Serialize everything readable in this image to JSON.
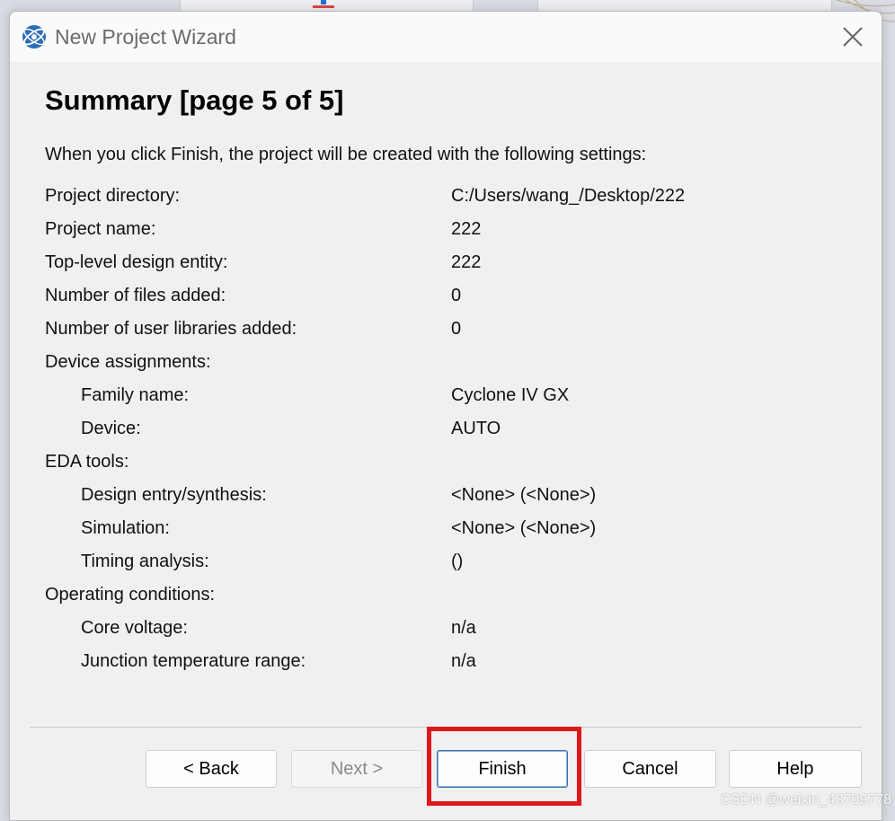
{
  "window": {
    "title": "New Project Wizard"
  },
  "page": {
    "heading": "Summary [page 5 of 5]",
    "intro": "When you click Finish, the project will be created with the following settings:"
  },
  "settings": [
    {
      "label": "Project directory:",
      "value": "C:/Users/wang_/Desktop/222",
      "indent": false
    },
    {
      "label": "Project name:",
      "value": "222",
      "indent": false
    },
    {
      "label": "Top-level design entity:",
      "value": "222",
      "indent": false
    },
    {
      "label": "Number of files added:",
      "value": "0",
      "indent": false
    },
    {
      "label": "Number of user libraries added:",
      "value": "0",
      "indent": false
    },
    {
      "label": "Device assignments:",
      "value": "",
      "indent": false
    },
    {
      "label": "Family name:",
      "value": "Cyclone IV GX",
      "indent": true
    },
    {
      "label": "Device:",
      "value": "AUTO",
      "indent": true
    },
    {
      "label": "EDA tools:",
      "value": "",
      "indent": false
    },
    {
      "label": "Design entry/synthesis:",
      "value": "<None> (<None>)",
      "indent": true
    },
    {
      "label": "Simulation:",
      "value": "<None> (<None>)",
      "indent": true
    },
    {
      "label": "Timing analysis:",
      "value": " ()",
      "indent": true
    },
    {
      "label": "Operating conditions:",
      "value": "",
      "indent": false
    },
    {
      "label": "Core voltage:",
      "value": "n/a",
      "indent": true
    },
    {
      "label": "Junction temperature range:",
      "value": "n/a",
      "indent": true
    }
  ],
  "buttons": {
    "back": "< Back",
    "next": "Next >",
    "finish": "Finish",
    "cancel": "Cancel",
    "help": "Help"
  },
  "watermark": "CSDN @weixin_43709778",
  "colors": {
    "highlight": "#e0161b",
    "default_button_border": "#3c6fb0"
  }
}
